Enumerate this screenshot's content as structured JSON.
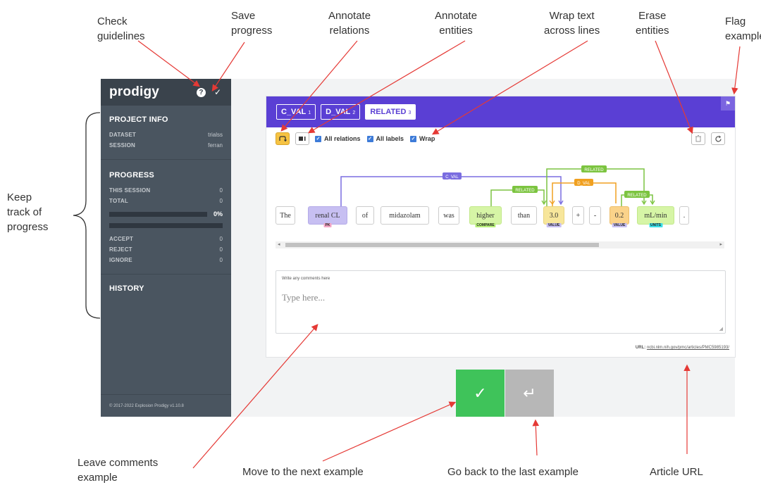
{
  "annotations": {
    "check_guidelines": "Check\nguidelines",
    "save_progress": "Save\nprogress",
    "annotate_relations": "Annotate\nrelations",
    "annotate_entities": "Annotate\nentities",
    "wrap_text": "Wrap text\nacross lines",
    "erase_entities": "Erase\nentities",
    "flag_examples": "Flag\nexamples",
    "keep_track": "Keep\ntrack of\nprogress",
    "leave_comments": "Leave comments\nexample",
    "move_next": "Move to the next example",
    "go_back": "Go back to the last example",
    "article_url": "Article URL"
  },
  "sidebar": {
    "logo": "prodigy",
    "help_icon": "?",
    "check_icon": "✓",
    "project_info": {
      "title": "PROJECT INFO",
      "rows": [
        {
          "key": "DATASET",
          "value": "trialss"
        },
        {
          "key": "SESSION",
          "value": "ferran"
        }
      ]
    },
    "progress": {
      "title": "PROGRESS",
      "rows": [
        {
          "key": "THIS SESSION",
          "value": "0"
        },
        {
          "key": "TOTAL",
          "value": "0"
        }
      ],
      "percent_label": "0%",
      "progress_fraction": 0,
      "counts": [
        {
          "key": "ACCEPT",
          "value": "0"
        },
        {
          "key": "REJECT",
          "value": "0"
        },
        {
          "key": "IGNORE",
          "value": "0"
        }
      ]
    },
    "history_title": "HISTORY",
    "footer": "© 2017-2022 Explosion   Prodigy v1.10.8"
  },
  "card": {
    "labels": [
      {
        "name": "C_VAL",
        "key": "1",
        "active": false
      },
      {
        "name": "D_VAL",
        "key": "2",
        "active": false
      },
      {
        "name": "RELATED",
        "key": "3",
        "active": true
      }
    ],
    "toolbar": {
      "relations_icon": "relations-icon",
      "entities_icon": "entities-icon",
      "checkboxes": [
        {
          "label": "All relations",
          "checked": true
        },
        {
          "label": "All labels",
          "checked": true
        },
        {
          "label": "Wrap",
          "checked": true
        }
      ],
      "erase_icon": "trash-icon",
      "reset_icon": "refresh-icon"
    },
    "tokens": [
      {
        "text": "The"
      },
      {
        "text": "renal CL",
        "label": "PK",
        "color": "#c7bff2",
        "label_color": "#f4a6c6"
      },
      {
        "text": "of"
      },
      {
        "text": "midazolam"
      },
      {
        "text": "was"
      },
      {
        "text": "higher",
        "label": "COMPARE",
        "color": "#d6f5a6",
        "label_color": "#b8f07a"
      },
      {
        "text": "than"
      },
      {
        "text": "3.0",
        "label": "VALUE",
        "color": "#f7e69b",
        "label_color": "#c7bff2"
      },
      {
        "text": "+"
      },
      {
        "text": "-"
      },
      {
        "text": "0.2",
        "label": "VALUE",
        "color": "#fbd38a",
        "label_color": "#c7bff2"
      },
      {
        "text": "mL/min",
        "label": "UNITS",
        "color": "#d6f5a6",
        "label_color": "#3ce0e8"
      },
      {
        "text": "."
      }
    ],
    "relation_labels": {
      "c_val": "C_VAL",
      "d_val": "D_VAL",
      "related": "RELATED"
    },
    "comment_label": "Write any comments here",
    "comment_placeholder": "Type here...",
    "url_label": "URL:",
    "url_value": "ncbi.nlm.nih.gov/pmc/articles/PMC5985193/"
  },
  "actions": {
    "accept_icon": "✓",
    "undo_icon": "↵"
  },
  "colors": {
    "sidebar_bg": "#4a5560",
    "header_purple": "#5a3fd4",
    "accept_green": "#3fc35a",
    "undo_gray": "#b7b7b7",
    "arrow_red": "#e53935",
    "rel_cval": "#7a6de0",
    "rel_dval": "#f0a020",
    "rel_related": "#7cc440"
  }
}
